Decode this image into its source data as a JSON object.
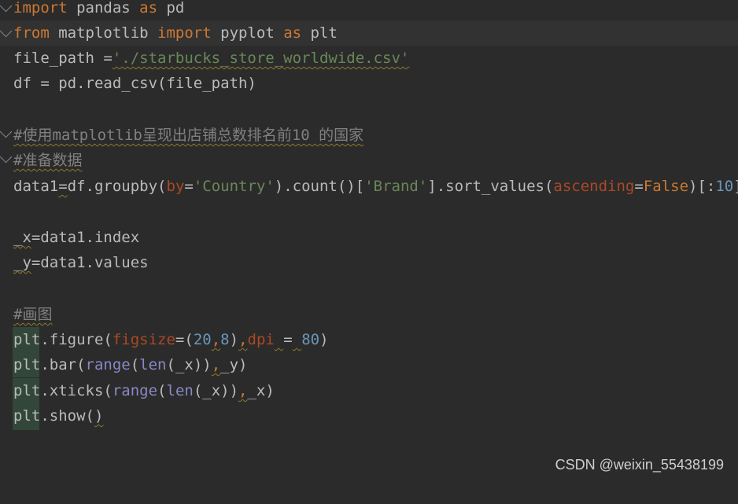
{
  "editor": {
    "lines": [
      {
        "tokens": [
          {
            "t": "import",
            "c": "kw"
          },
          {
            "t": " pandas "
          },
          {
            "t": "as",
            "c": "kw"
          },
          {
            "t": " pd"
          }
        ]
      },
      {
        "tokens": [
          {
            "t": "from",
            "c": "kw"
          },
          {
            "t": " matplotlib "
          },
          {
            "t": "import",
            "c": "kw"
          },
          {
            "t": " pyplot "
          },
          {
            "t": "as",
            "c": "kw"
          },
          {
            "t": " plt"
          }
        ]
      },
      {
        "tokens": [
          {
            "t": "file_path ="
          },
          {
            "t": "'./starbucks_store_worldwide.csv'",
            "c": "str wavy"
          }
        ]
      },
      {
        "tokens": [
          {
            "t": "df = pd.read_csv(file_path)"
          }
        ]
      },
      {
        "tokens": []
      },
      {
        "tokens": [
          {
            "t": "#使用matplotlib呈现出店铺总数排名前10 的国家",
            "c": "cmt wavy"
          }
        ]
      },
      {
        "tokens": [
          {
            "t": "#准备数据",
            "c": "cmt wavy"
          }
        ]
      },
      {
        "tokens": [
          {
            "t": "data1"
          },
          {
            "t": "=",
            "c": "wavy"
          },
          {
            "t": "df.groupby("
          },
          {
            "t": "by",
            "c": "param"
          },
          {
            "t": "="
          },
          {
            "t": "'Country'",
            "c": "str"
          },
          {
            "t": ").count()["
          },
          {
            "t": "'Brand'",
            "c": "str"
          },
          {
            "t": "].sort_values("
          },
          {
            "t": "ascending",
            "c": "param"
          },
          {
            "t": "="
          },
          {
            "t": "False",
            "c": "kw"
          },
          {
            "t": ")[:"
          },
          {
            "t": "10",
            "c": "num"
          },
          {
            "t": "]"
          }
        ]
      },
      {
        "tokens": []
      },
      {
        "tokens": [
          {
            "t": "_x",
            "c": "wavy"
          },
          {
            "t": "=data1.index"
          }
        ]
      },
      {
        "tokens": [
          {
            "t": "_y",
            "c": "wavy"
          },
          {
            "t": "=data1.values"
          }
        ]
      },
      {
        "tokens": []
      },
      {
        "tokens": [
          {
            "t": "#画图",
            "c": "cmt wavy"
          }
        ]
      },
      {
        "tokens": [
          {
            "t": "plt.figure("
          },
          {
            "t": "figsize",
            "c": "param"
          },
          {
            "t": "=("
          },
          {
            "t": "20",
            "c": "num"
          },
          {
            "t": ",",
            "c": "kw wavy"
          },
          {
            "t": "8",
            "c": "num"
          },
          {
            "t": ")"
          },
          {
            "t": ",",
            "c": "kw wavy"
          },
          {
            "t": "dpi",
            "c": "param"
          },
          {
            "t": " ",
            "c": "wavy"
          },
          {
            "t": "="
          },
          {
            "t": " ",
            "c": "wavy"
          },
          {
            "t": "80",
            "c": "num"
          },
          {
            "t": ")"
          }
        ]
      },
      {
        "tokens": [
          {
            "t": "plt.bar("
          },
          {
            "t": "range",
            "c": "bi"
          },
          {
            "t": "("
          },
          {
            "t": "len",
            "c": "bi"
          },
          {
            "t": "(_x))"
          },
          {
            "t": ",",
            "c": "kw wavy"
          },
          {
            "t": "_y)"
          }
        ]
      },
      {
        "tokens": [
          {
            "t": "plt.xticks("
          },
          {
            "t": "range",
            "c": "bi"
          },
          {
            "t": "("
          },
          {
            "t": "len",
            "c": "bi"
          },
          {
            "t": "(_x))"
          },
          {
            "t": ",",
            "c": "kw wavy"
          },
          {
            "t": "_x)"
          }
        ]
      },
      {
        "tokens": [
          {
            "t": "plt.show("
          },
          {
            "t": ")",
            "c": "wavy"
          }
        ]
      }
    ]
  },
  "watermark": "CSDN @weixin_55438199"
}
